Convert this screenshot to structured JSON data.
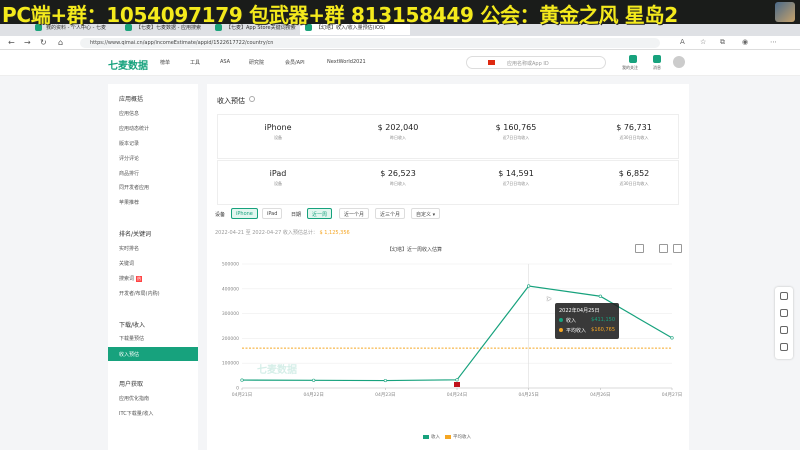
{
  "banner": {
    "text": "PC端+群：1054097179 包武器+群 813158449 公会：黄金之风 星岛2"
  },
  "browser": {
    "tabs": [
      {
        "label": "我的资料 - 个人中心 - 七麦"
      },
      {
        "label": "【七麦】七麦数据 - 应用搜索"
      },
      {
        "label": "【七麦】App Store关键词搜索"
      },
      {
        "label": "【幻塔】收入/收入量预估(iOS)"
      }
    ],
    "url": "https://www.qimai.cn/app/incomeEstimate/appid/1522617722/country/cn"
  },
  "site": {
    "logo": "七麦数据",
    "menu": [
      "榜单",
      "工具",
      "ASA",
      "研究院",
      "会员/API",
      "NextWorld2021"
    ],
    "search_placeholder": "应用名称或App ID",
    "top_icons": [
      {
        "label": "我的关注"
      },
      {
        "label": "消息"
      }
    ]
  },
  "sidebar": {
    "groups": [
      {
        "title": "应用概括",
        "items": [
          "应用信息",
          "应用动态统计",
          "版本记录",
          "评分评论",
          "商品排行",
          "同开发者应用",
          "苹果推荐"
        ]
      },
      {
        "title": "排名/关键词",
        "items": [
          "实时排名",
          "关键词",
          "搜索词",
          "开发者/布局(内购)"
        ]
      },
      {
        "title": "下载/收入",
        "items": [
          "下载量预估",
          "收入预估"
        ]
      },
      {
        "title": "用户获取",
        "items": [
          "应用优化指南",
          "ITC下载量/收入"
        ]
      }
    ],
    "hot_badge": "热",
    "active_item": "收入预估"
  },
  "main": {
    "title": "收入预估",
    "stats": [
      {
        "device": "iPhone",
        "device_sub": "设备",
        "values": [
          "$ 202,040",
          "$ 160,765",
          "$ 76,731"
        ],
        "labels": [
          "昨日收入",
          "近7日日均收入",
          "近30日日均收入"
        ]
      },
      {
        "device": "iPad",
        "device_sub": "设备",
        "values": [
          "$ 26,523",
          "$ 14,591",
          "$ 6,852"
        ],
        "labels": [
          "昨日收入",
          "近7日日均收入",
          "近30日日均收入"
        ]
      }
    ],
    "filters": {
      "device_label": "设备",
      "devices": [
        "iPhone",
        "iPad"
      ],
      "date_label": "日期",
      "dates": [
        "近一周",
        "近一个月",
        "近三个月",
        "自定义 ▾"
      ]
    },
    "range_text": "2022-04-21 至 2022-04-27 收入预估总计：",
    "range_total": "$ 1,125,356",
    "chart_title": "【幻塔】近一周收入估算",
    "watermark": "七麦数据",
    "legend": [
      "收入",
      "平均收入"
    ],
    "tooltip": {
      "date": "2022年04月25日",
      "rows": [
        {
          "label": "收入",
          "value": "$411,150"
        },
        {
          "label": "平均收入",
          "value": "$160,765"
        }
      ]
    }
  },
  "colors": {
    "brand": "#17a27d",
    "average": "#f5a623",
    "tooltip_bg": "#1e1e1e"
  },
  "chart_data": {
    "type": "line",
    "title": "【幻塔】近一周收入估算",
    "x": [
      "04月21日",
      "04月22日",
      "04月23日",
      "04月24日",
      "04月25日",
      "04月26日",
      "04月27日"
    ],
    "series": [
      {
        "name": "收入",
        "values": [
          32000,
          31000,
          30000,
          33000,
          411150,
          370000,
          202040
        ]
      },
      {
        "name": "平均收入",
        "values": [
          160765,
          160765,
          160765,
          160765,
          160765,
          160765,
          160765
        ]
      }
    ],
    "y_ticks": [
      "0",
      "100000",
      "200000",
      "300000",
      "400000",
      "500000"
    ],
    "ylim": [
      0,
      500000
    ],
    "grid": true,
    "legend": "bottom-center"
  }
}
